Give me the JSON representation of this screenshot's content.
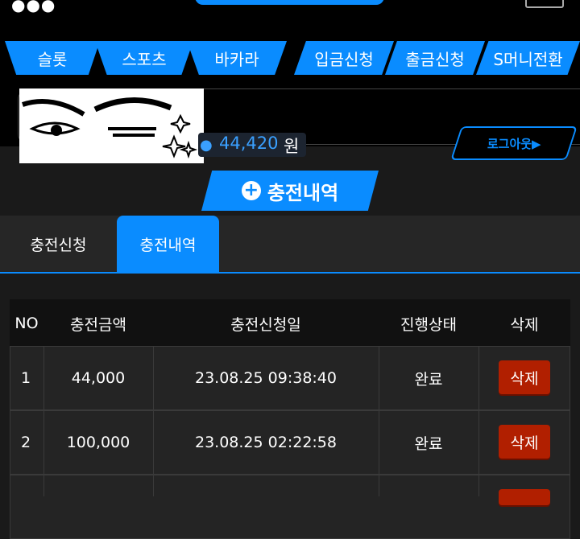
{
  "nav": {
    "items": [
      "슬롯",
      "스포츠",
      "바카라",
      "입금신청",
      "출금신청",
      "S머니전환"
    ],
    "logout_label": "로그아웃▶"
  },
  "account": {
    "money": "44,420",
    "unit": "원"
  },
  "section": {
    "title": "충전내역"
  },
  "tabs": [
    {
      "label": "충전신청",
      "active": false
    },
    {
      "label": "충전내역",
      "active": true
    }
  ],
  "table": {
    "headers": [
      "NO",
      "충전금액",
      "충전신청일",
      "진행상태",
      "삭제"
    ],
    "rows": [
      {
        "no": "1",
        "amount": "44,000",
        "date": "23.08.25 09:38:40",
        "status": "완료",
        "delete_label": "삭제"
      },
      {
        "no": "2",
        "amount": "100,000",
        "date": "23.08.25 02:22:58",
        "status": "완료",
        "delete_label": "삭제"
      }
    ]
  },
  "colors": {
    "accent": "#0a8cff",
    "delete": "#b11f00",
    "background": "#1a1a1a"
  }
}
